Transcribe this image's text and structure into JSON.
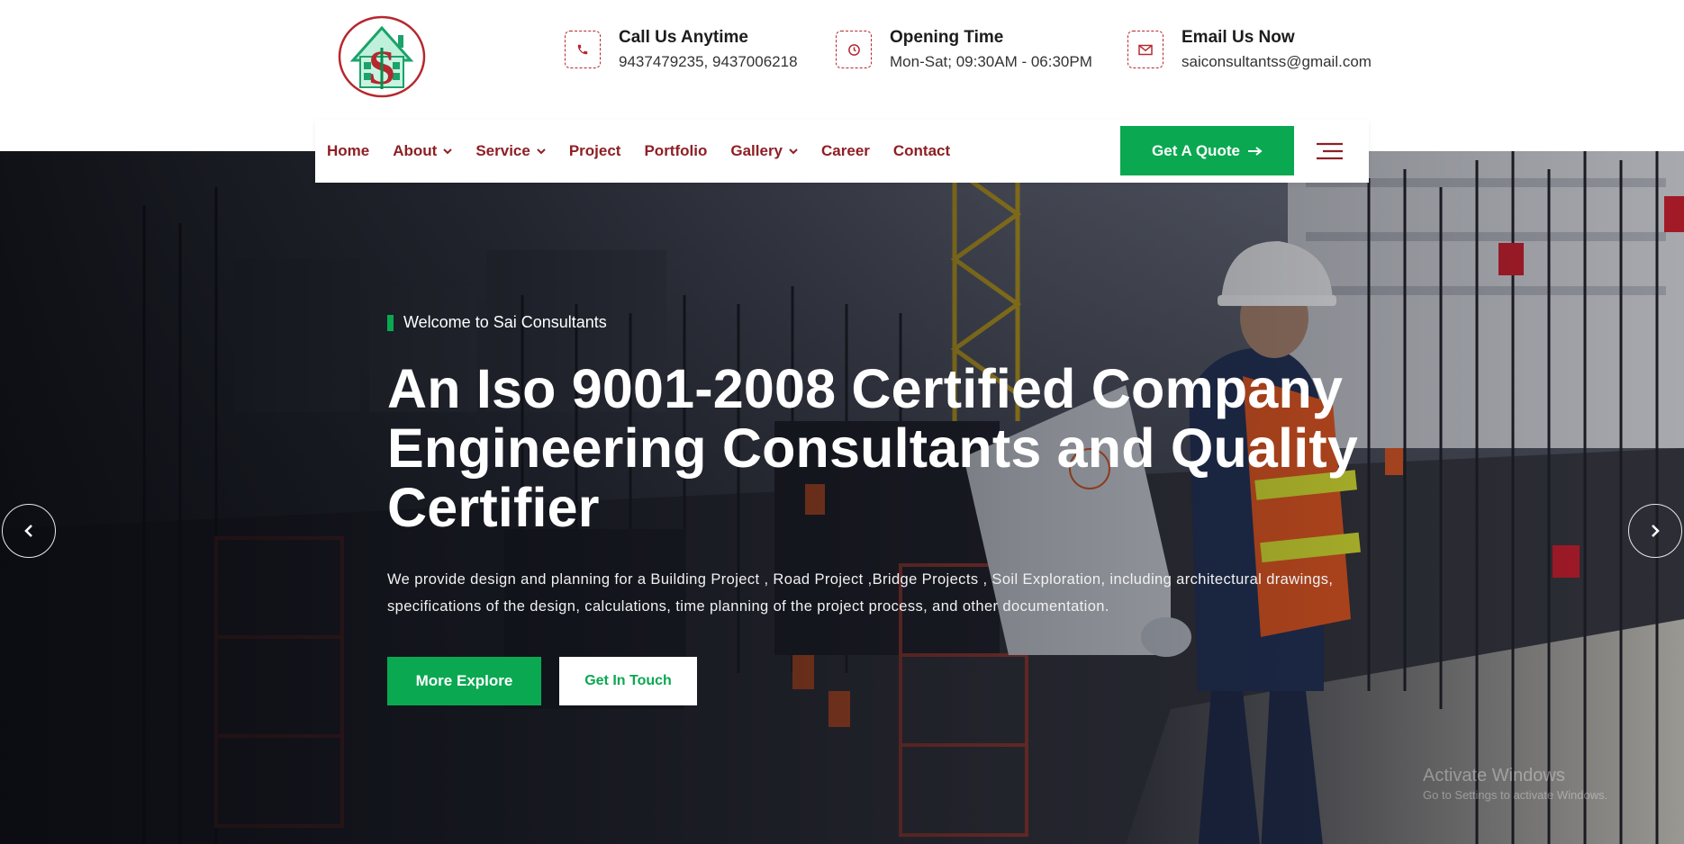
{
  "header": {
    "logo_alt": "Sai Consultants logo",
    "contacts": [
      {
        "title": "Call Us Anytime",
        "text": "9437479235, 9437006218",
        "icon": "phone-icon"
      },
      {
        "title": "Opening Time",
        "text": "Mon-Sat; 09:30AM - 06:30PM",
        "icon": "clock-icon"
      },
      {
        "title": "Email Us Now",
        "text": "saiconsultantss@gmail.com",
        "icon": "envelope-icon"
      }
    ]
  },
  "nav": {
    "items": [
      {
        "label": "Home",
        "dropdown": false
      },
      {
        "label": "About",
        "dropdown": true
      },
      {
        "label": "Service",
        "dropdown": true
      },
      {
        "label": "Project",
        "dropdown": false
      },
      {
        "label": "Portfolio",
        "dropdown": false
      },
      {
        "label": "Gallery",
        "dropdown": true
      },
      {
        "label": "Career",
        "dropdown": false
      },
      {
        "label": "Contact",
        "dropdown": false
      }
    ],
    "quote_label": "Get A Quote",
    "menu_icon": "hamburger-icon"
  },
  "hero": {
    "tagline": "Welcome to Sai Consultants",
    "headline_lines": [
      "An Iso 9001-2008 Certified Company",
      "Engineering Consultants and Quality",
      "Certifier"
    ],
    "description": "We provide design and planning for a Building Project , Road Project ,Bridge Projects , Soil Exploration, including architectural drawings, specifications of the design, calculations, time planning of the project process, and other documentation.",
    "btn_explore": "More Explore",
    "btn_touch": "Get In Touch",
    "prev_icon": "chevron-left-icon",
    "next_icon": "chevron-right-icon"
  },
  "watermark": {
    "line1": "Activate Windows",
    "line2": "Go to Settings to activate Windows."
  },
  "colors": {
    "brand_red": "#8e1f24",
    "brand_green": "#0aa851",
    "icon_border": "#b5282f"
  }
}
